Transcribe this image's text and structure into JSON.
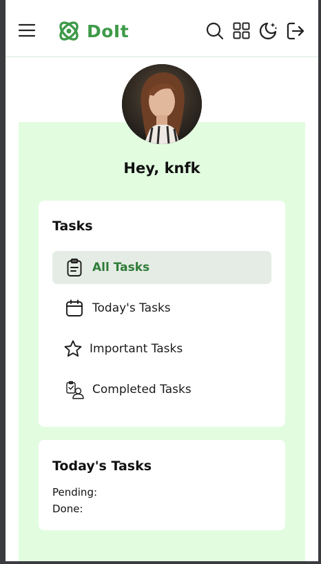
{
  "header": {
    "brand_name": "DoIt",
    "icons": [
      "menu-icon",
      "logo-icon",
      "search-icon",
      "grid-icon",
      "dark-mode-icon",
      "logout-icon"
    ],
    "brand_color": "#3e9a49"
  },
  "profile": {
    "greeting": "Hey, knfk"
  },
  "tasks_nav": {
    "title": "Tasks",
    "items": [
      {
        "label": "All Tasks",
        "icon": "clipboard-icon",
        "active": true
      },
      {
        "label": "Today's Tasks",
        "icon": "calendar-icon",
        "active": false
      },
      {
        "label": "Important Tasks",
        "icon": "star-icon",
        "active": false
      },
      {
        "label": "Completed Tasks",
        "icon": "completed-icon",
        "active": false
      }
    ]
  },
  "today_summary": {
    "title": "Today's Tasks",
    "pending_label": "Pending:",
    "done_label": "Done:"
  },
  "colors": {
    "panel_bg": "#e2fce0",
    "active_item_bg": "#e5ece5",
    "active_item_text": "#2f7b38"
  }
}
